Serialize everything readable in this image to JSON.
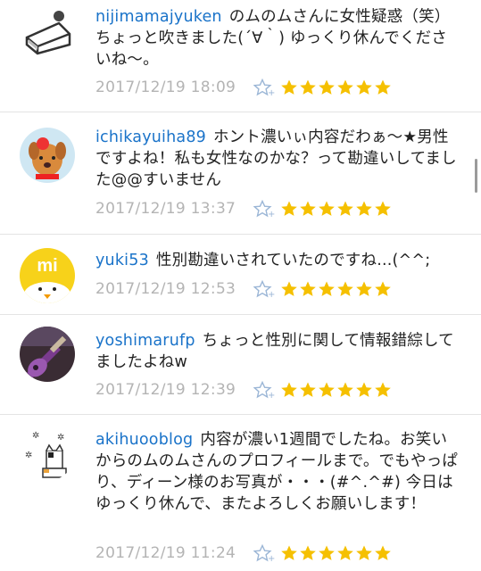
{
  "comments": [
    {
      "username": "nijimamajyuken",
      "text": "のムのムさんに女性疑惑（笑）ちょっと吹きました(´∀｀) ゆっくり休んでくださいね〜。",
      "date": "2017/12/19 18:09",
      "avatar_icon": "cake-icon",
      "stars": 6
    },
    {
      "username": "ichikayuiha89",
      "text": "ホント濃いぃ内容だわぁ〜★男性ですよね！私も女性なのかな？って勘違いしてました@@すいません",
      "date": "2017/12/19 13:37",
      "avatar_icon": "dog-icon",
      "stars": 6
    },
    {
      "username": "yuki53",
      "text": "性別勘違いされていたのですね...(^^;",
      "date": "2017/12/19 12:53",
      "avatar_icon": "mi-chick-icon",
      "stars": 6
    },
    {
      "username": "yoshimarufp",
      "text": "ちょっと性別に関して情報錯綜してましたよねw",
      "date": "2017/12/19 12:39",
      "avatar_icon": "guitar-photo-icon",
      "stars": 6
    },
    {
      "username": "akihuooblog",
      "text": "内容が濃い1週間でしたね。お笑いからのムのムさんのプロフィールまで。でもやっぱり、ディーン様のお写真が・・・(#^.^#) 今日はゆっくり休んで、またよろしくお願いします！",
      "date": "2017/12/19 11:24",
      "avatar_icon": "cat-doodle-icon",
      "stars": 6
    }
  ],
  "colors": {
    "username": "#1a73c9",
    "date": "#b4b4b4",
    "star": "#f5c000",
    "add_star": "#9bb6d6"
  }
}
